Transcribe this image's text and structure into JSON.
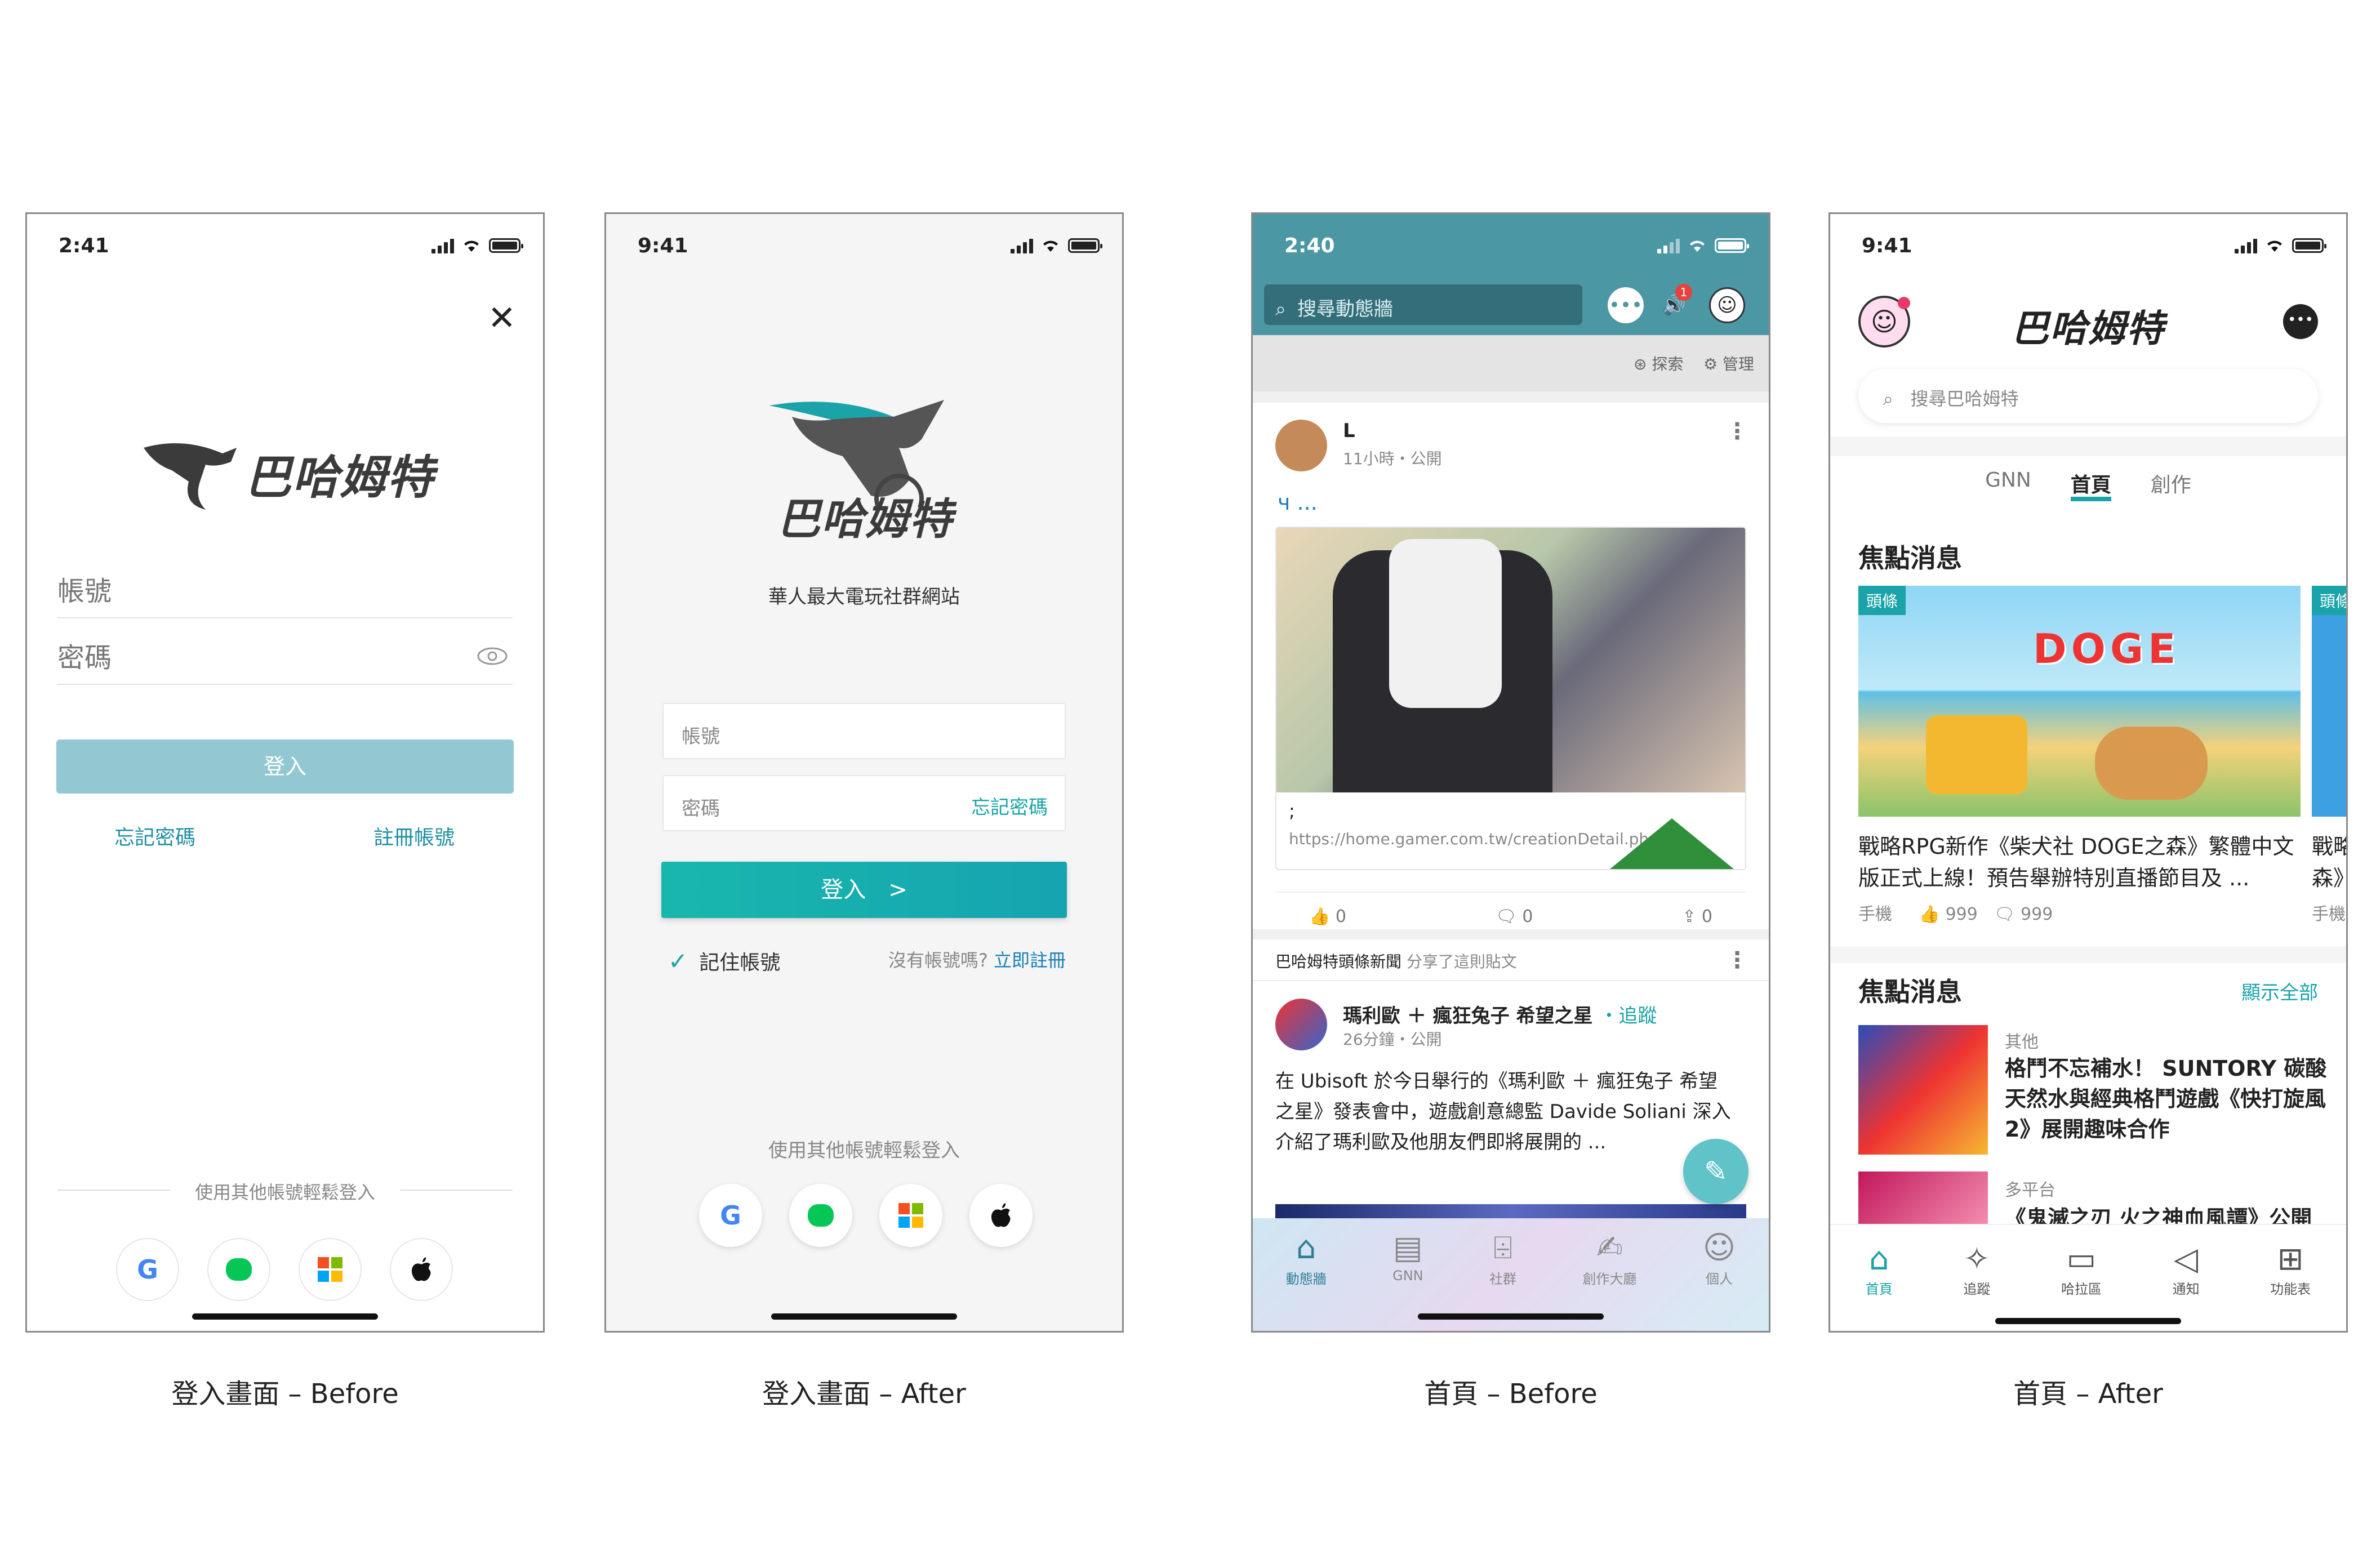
{
  "colors": {
    "accent": "#1aa3a8",
    "before_header": "#4c97a4",
    "before_button": "#93c8d2"
  },
  "captions": [
    "登入畫面 – Before",
    "登入畫面 – After",
    "首頁 – Before",
    "首頁 – After"
  ],
  "login_before": {
    "time": "2:41",
    "logo": "巴哈姆特",
    "account_label": "帳號",
    "password_label": "密碼",
    "login_button": "登入",
    "forgot": "忘記密碼",
    "register": "註冊帳號",
    "other_login": "使用其他帳號輕鬆登入"
  },
  "login_after": {
    "time": "9:41",
    "logo": "巴哈姆特",
    "tagline": "華人最大電玩社群網站",
    "account_placeholder": "帳號",
    "password_placeholder": "密碼",
    "forgot": "忘記密碼",
    "login_button": "登入　>",
    "remember": "記住帳號",
    "no_account": "沒有帳號嗎?",
    "register_now": "立即註冊",
    "other_login": "使用其他帳號輕鬆登入"
  },
  "home_before": {
    "time": "2:40",
    "search_placeholder": "搜尋動態牆",
    "notif_badge": "1",
    "explore": "探索",
    "manage": "管理",
    "post1": {
      "author": "L",
      "meta": "11小時・公開",
      "text": "ч ...",
      "caption": ";",
      "link": "https://home.gamer.com.tw/creationDetail.php?s...",
      "likes": "0",
      "comments": "0",
      "shares": "0"
    },
    "share": {
      "source": "巴哈姆特頭條新聞",
      "action": "分享了這則貼文"
    },
    "post2": {
      "author": "瑪利歐 ＋ 瘋狂兔子 希望之星",
      "follow": "追蹤",
      "meta": "26分鐘・公開",
      "text": "在 Ubisoft 於今日舉行的《瑪利歐 ＋ 瘋狂兔子 希望之星》發表會中，遊戲創意總監 Davide Soliani 深入介紹了瑪利歐及他朋友們即將展開的 ..."
    },
    "tabs": [
      {
        "icon": "home-icon",
        "label": "動態牆"
      },
      {
        "icon": "news-icon",
        "label": "GNN"
      },
      {
        "icon": "community-icon",
        "label": "社群"
      },
      {
        "icon": "create-icon",
        "label": "創作大廳"
      },
      {
        "icon": "profile-icon",
        "label": "個人"
      }
    ]
  },
  "home_after": {
    "time": "9:41",
    "logo": "巴哈姆特",
    "search_placeholder": "搜尋巴哈姆特",
    "tabs": [
      "GNN",
      "首頁",
      "創作"
    ],
    "section1": "焦點消息",
    "banner_tag": "頭條",
    "banner_title": "戰略RPG新作《柴犬社 DOGE之森》繁體中文版正式上線！預告舉辦特別直播節目及 ...",
    "banner_platform": "手機",
    "banner_likes": "999",
    "banner_comments": "999",
    "banner_art": "DOGE",
    "banner2_tag": "頭條",
    "banner2_title": "戰略\n森》",
    "banner2_platform": "手機",
    "section2": "焦點消息",
    "see_all": "顯示全部",
    "news1": {
      "category": "其他",
      "title": "格鬥不忘補水！ SUNTORY 碳酸天然水與經典格鬥遊戲《快打旋風 2》展開趣味合作"
    },
    "news2": {
      "category": "多平台",
      "title": "《鬼滅之刃 火之神血風譚》公開"
    },
    "bottom_tabs": [
      {
        "icon": "home-icon",
        "label": "首頁"
      },
      {
        "icon": "follow-icon",
        "label": "追蹤"
      },
      {
        "icon": "forum-icon",
        "label": "哈拉區"
      },
      {
        "icon": "notify-icon",
        "label": "通知"
      },
      {
        "icon": "apps-icon",
        "label": "功能表"
      }
    ]
  }
}
